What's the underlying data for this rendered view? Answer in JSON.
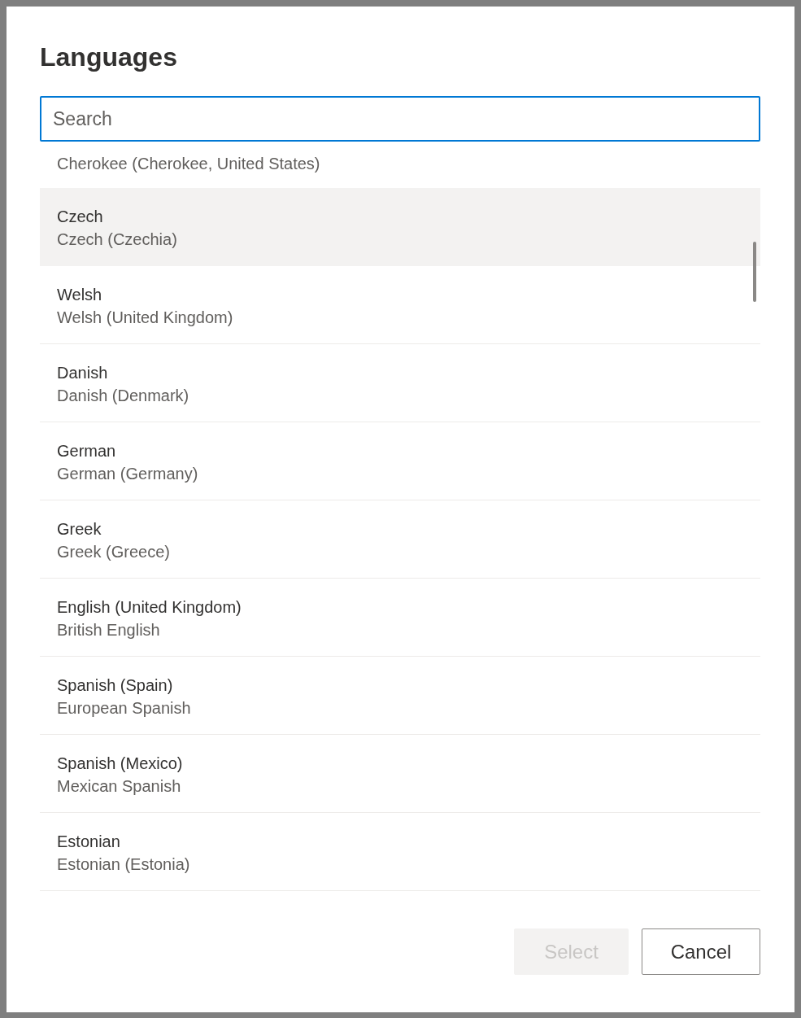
{
  "dialog": {
    "title": "Languages"
  },
  "search": {
    "placeholder": "Search"
  },
  "list": {
    "partial_item": {
      "secondary": "Cherokee (Cherokee, United States)"
    },
    "items": [
      {
        "primary": "Czech",
        "secondary": "Czech (Czechia)",
        "selected": true
      },
      {
        "primary": "Welsh",
        "secondary": "Welsh (United Kingdom)",
        "selected": false
      },
      {
        "primary": "Danish",
        "secondary": "Danish (Denmark)",
        "selected": false
      },
      {
        "primary": "German",
        "secondary": "German (Germany)",
        "selected": false
      },
      {
        "primary": "Greek",
        "secondary": "Greek (Greece)",
        "selected": false
      },
      {
        "primary": "English (United Kingdom)",
        "secondary": "British English",
        "selected": false
      },
      {
        "primary": "Spanish (Spain)",
        "secondary": "European Spanish",
        "selected": false
      },
      {
        "primary": "Spanish (Mexico)",
        "secondary": "Mexican Spanish",
        "selected": false
      },
      {
        "primary": "Estonian",
        "secondary": "Estonian (Estonia)",
        "selected": false
      }
    ]
  },
  "buttons": [
    {
      "label": "Select",
      "kind": "primary",
      "disabled": true
    },
    {
      "label": "Cancel",
      "kind": "secondary",
      "disabled": false
    }
  ]
}
